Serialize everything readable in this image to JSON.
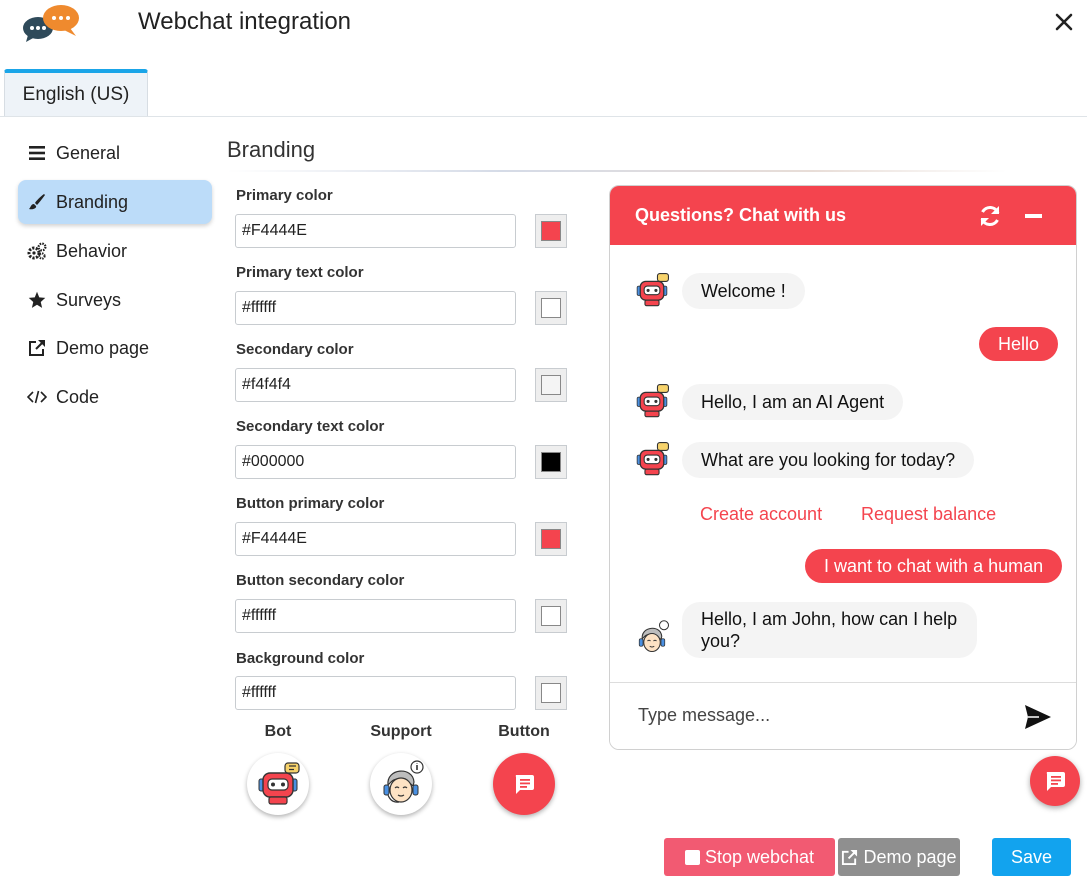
{
  "header": {
    "title": "Webchat integration"
  },
  "tabs": [
    {
      "label": "English (US)"
    }
  ],
  "sidebar": {
    "items": [
      {
        "label": "General",
        "icon": "menu-icon"
      },
      {
        "label": "Branding",
        "icon": "brush-icon",
        "active": true
      },
      {
        "label": "Behavior",
        "icon": "gears-icon"
      },
      {
        "label": "Surveys",
        "icon": "star-icon"
      },
      {
        "label": "Demo page",
        "icon": "external-link-icon"
      },
      {
        "label": "Code",
        "icon": "code-icon"
      }
    ]
  },
  "branding": {
    "title": "Branding",
    "fields": [
      {
        "label": "Primary color",
        "value": "#F4444E",
        "swatch": "#F4444E"
      },
      {
        "label": "Primary text color",
        "value": "#ffffff",
        "swatch": "#ffffff"
      },
      {
        "label": "Secondary color",
        "value": "#f4f4f4",
        "swatch": "#f4f4f4"
      },
      {
        "label": "Secondary text color",
        "value": "#000000",
        "swatch": "#000000"
      },
      {
        "label": "Button primary color",
        "value": "#F4444E",
        "swatch": "#F4444E"
      },
      {
        "label": "Button secondary color",
        "value": "#ffffff",
        "swatch": "#ffffff"
      },
      {
        "label": "Background color",
        "value": "#ffffff",
        "swatch": "#ffffff"
      }
    ],
    "icons": {
      "bot_label": "Bot",
      "support_label": "Support",
      "button_label": "Button"
    }
  },
  "preview": {
    "header_title": "Questions? Chat with us",
    "messages": [
      {
        "from": "bot",
        "text": "Welcome !"
      },
      {
        "from": "user",
        "text": "Hello"
      },
      {
        "from": "bot",
        "text": "Hello, I am an AI Agent"
      },
      {
        "from": "bot",
        "text": "What are you looking for today?"
      },
      {
        "from": "user",
        "text": "I want to chat with a human"
      },
      {
        "from": "support",
        "text": "Hello, I am John, how can I help you?"
      }
    ],
    "quick_replies": [
      "Create account",
      "Request balance"
    ],
    "input_placeholder": "Type message..."
  },
  "footer": {
    "stop_label": "Stop webchat",
    "demo_label": "Demo page",
    "save_label": "Save"
  },
  "colors": {
    "primary": "#F4444E",
    "accent_blue": "#1aa5e8",
    "active_nav": "#bcdcf9",
    "stop_button": "#f25a72",
    "demo_button": "#8f8f8f",
    "save_button": "#12a3ee"
  }
}
